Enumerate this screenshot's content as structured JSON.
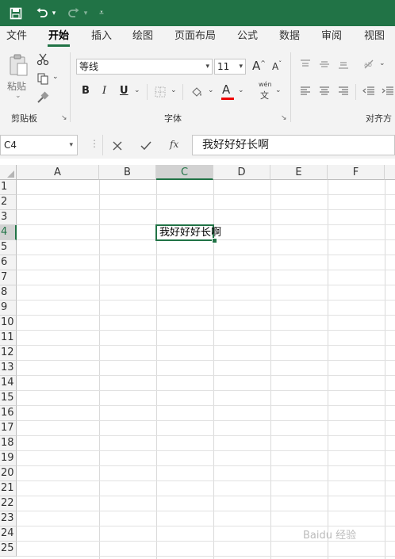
{
  "tabs": [
    "文件",
    "开始",
    "插入",
    "绘图",
    "页面布局",
    "公式",
    "数据",
    "审阅",
    "视图"
  ],
  "active_tab": "开始",
  "ribbon": {
    "paste_label": "粘贴",
    "clipboard_label": "剪贴板",
    "font_name": "等线",
    "font_size": "11",
    "font_group_label": "字体",
    "align_group_label": "对齐方",
    "bold": "B",
    "italic": "I",
    "underline": "U",
    "font_color_glyph": "A",
    "phonetic_glyph": "wén",
    "phonetic_sub": "文",
    "grow_font": "A",
    "shrink_font": "A"
  },
  "formula_bar": {
    "name_box": "C4",
    "fx_label": "fx",
    "content": "我好好好长啊"
  },
  "columns": [
    "A",
    "B",
    "C",
    "D",
    "E",
    "F"
  ],
  "selected_column": "C",
  "rows": [
    "1",
    "2",
    "3",
    "4",
    "5",
    "6",
    "7",
    "8",
    "9",
    "10",
    "11",
    "12",
    "13",
    "14",
    "15",
    "16",
    "17",
    "18",
    "19",
    "20",
    "21",
    "22",
    "23",
    "24",
    "25"
  ],
  "selected_row": "4",
  "cell_c4": "我好好好长啊",
  "accent_color": "#217346",
  "watermark": "Baidu 经验"
}
